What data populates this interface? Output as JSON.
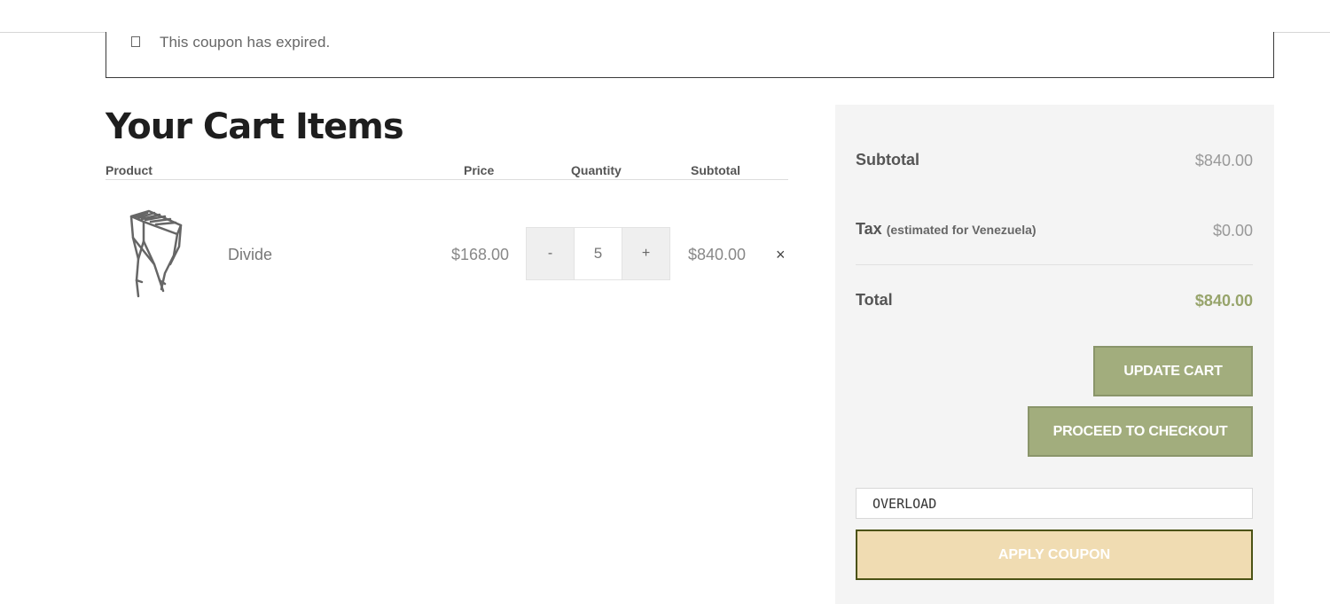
{
  "notice": {
    "message": "This coupon has expired."
  },
  "cart": {
    "title": "Your Cart Items",
    "columns": {
      "product": "Product",
      "price": "Price",
      "quantity": "Quantity",
      "subtotal": "Subtotal"
    },
    "items": [
      {
        "name": "Divide",
        "price": "$168.00",
        "quantity": "5",
        "qty_minus": "-",
        "qty_plus": "+",
        "subtotal": "$840.00",
        "remove": "×"
      }
    ]
  },
  "totals": {
    "subtotal_label": "Subtotal",
    "subtotal_value": "$840.00",
    "tax_label": "Tax",
    "tax_note": "(estimated for Venezuela)",
    "tax_value": "$0.00",
    "total_label": "Total",
    "total_value": "$840.00",
    "update_cart": "UPDATE CART",
    "checkout": "PROCEED TO CHECKOUT",
    "coupon_value": "OVERLOAD",
    "apply_coupon": "APPLY COUPON"
  },
  "colors": {
    "accent": "#a2ad7d",
    "total": "#97a46b",
    "coupon_button": "#f0dcb2"
  },
  "icons": {
    "notice": "info-icon",
    "remove": "close-icon"
  }
}
